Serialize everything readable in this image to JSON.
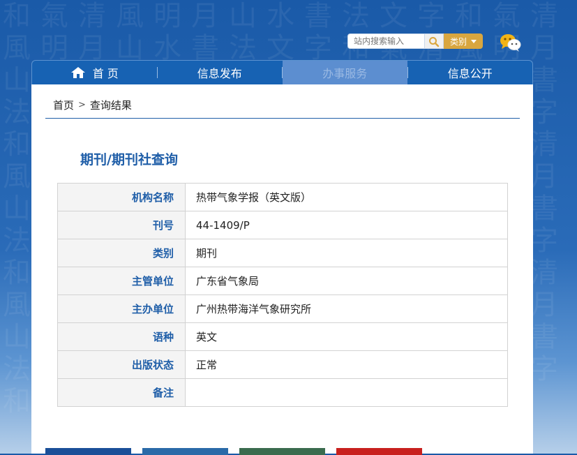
{
  "search": {
    "placeholder": "站内搜索输入",
    "category_label": "类别"
  },
  "nav": {
    "items": [
      {
        "label": "首 页"
      },
      {
        "label": "信息发布"
      },
      {
        "label": "办事服务"
      },
      {
        "label": "信息公开"
      }
    ],
    "active_index": 2
  },
  "breadcrumb": {
    "home": "首页",
    "separator": ">",
    "current": "查询结果"
  },
  "page_title": "期刊/期刊社查询",
  "table": {
    "rows": [
      {
        "key": "机构名称",
        "value": "热带气象学报（英文版）"
      },
      {
        "key": "刊号",
        "value": "44-1409/P"
      },
      {
        "key": "类别",
        "value": "期刊"
      },
      {
        "key": "主管单位",
        "value": "广东省气象局"
      },
      {
        "key": "主办单位",
        "value": "广州热带海洋气象研究所"
      },
      {
        "key": "语种",
        "value": "英文"
      },
      {
        "key": "出版状态",
        "value": "正常"
      },
      {
        "key": "备注",
        "value": ""
      }
    ]
  },
  "colors": {
    "brand_blue": "#1762b3",
    "accent_gold": "#d9a63f",
    "label_blue": "#1f5ea8",
    "thumb_colors": [
      "#1a4f98",
      "#2a6aa8",
      "#3a6b4e",
      "#c8201e"
    ]
  },
  "icons": {
    "home": "home-icon",
    "search": "magnifier-icon",
    "social": "wechat-icon"
  }
}
